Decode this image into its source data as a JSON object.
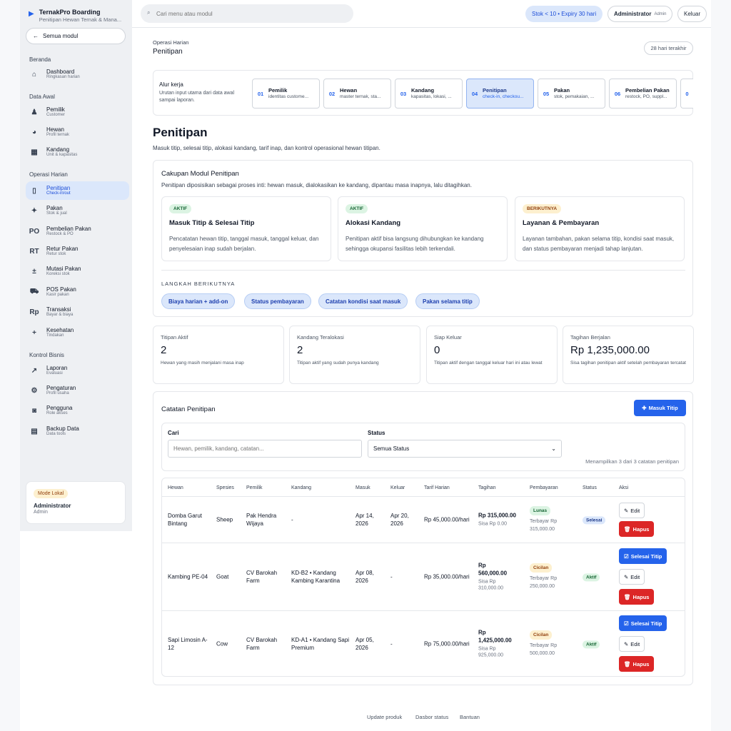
{
  "brand": {
    "title": "TernakPro Boarding",
    "subtitle": "Penitipan Hewan Ternak & Mana..."
  },
  "sidebar": {
    "all_modules": "Semua modul",
    "sections": [
      "Beranda",
      "Data Awal",
      "Operasi Harian",
      "Kontrol Bisnis"
    ],
    "items": [
      {
        "icon": "⌂",
        "label": "Dashboard",
        "sub": "Ringkasan harian"
      },
      {
        "icon": "♟",
        "label": "Pemilik",
        "sub": "Customer"
      },
      {
        "icon": "◕",
        "label": "Hewan",
        "sub": "Profil ternak"
      },
      {
        "icon": "▦",
        "label": "Kandang",
        "sub": "Unit & kapasitas"
      },
      {
        "icon": "▯",
        "label": "Penitipan",
        "sub": "Check-in/out"
      },
      {
        "icon": "✦",
        "label": "Pakan",
        "sub": "Stok & jual"
      },
      {
        "icon": "PO",
        "label": "Pembelian Pakan",
        "sub": "Restock & PO"
      },
      {
        "icon": "RT",
        "label": "Retur Pakan",
        "sub": "Retur stok"
      },
      {
        "icon": "±",
        "label": "Mutasi Pakan",
        "sub": "Koreksi stok"
      },
      {
        "icon": "⛟",
        "label": "POS Pakan",
        "sub": "Kasir pakan"
      },
      {
        "icon": "Rp",
        "label": "Transaksi",
        "sub": "Bayar & biaya"
      },
      {
        "icon": "+",
        "label": "Kesehatan",
        "sub": "Tindakan"
      },
      {
        "icon": "↗",
        "label": "Laporan",
        "sub": "Evaluasi"
      },
      {
        "icon": "⚙",
        "label": "Pengaturan",
        "sub": "Profil usaha"
      },
      {
        "icon": "◙",
        "label": "Pengguna",
        "sub": "Role akses"
      },
      {
        "icon": "▤",
        "label": "Backup Data",
        "sub": "Data tools"
      }
    ],
    "mode": {
      "badge": "Mode Lokal",
      "user": "Administrator",
      "role": "Admin"
    }
  },
  "topbar": {
    "search_placeholder": "Cari menu atau modul",
    "stock_alert": "Stok < 10 • Expiry 30 hari",
    "user": "Administrator",
    "role": "Admin",
    "logout": "Keluar"
  },
  "header": {
    "section": "Operasi Harian",
    "title": "Penitipan",
    "period": "28 hari terakhir"
  },
  "workflow": {
    "title": "Alur kerja",
    "desc": "Urutan input utama dari data awal sampai laporan.",
    "steps": [
      {
        "num": "01",
        "label": "Pemilik",
        "sub": "identitas custome..."
      },
      {
        "num": "02",
        "label": "Hewan",
        "sub": "master ternak, sta..."
      },
      {
        "num": "03",
        "label": "Kandang",
        "sub": "kapasitas, lokasi, ..."
      },
      {
        "num": "04",
        "label": "Penitipan",
        "sub": "check-in, checkou..."
      },
      {
        "num": "05",
        "label": "Pakan",
        "sub": "stok, pemakaian, ..."
      },
      {
        "num": "06",
        "label": "Pembelian Pakan",
        "sub": "restock, PO, suppl..."
      },
      {
        "num": "0"
      }
    ]
  },
  "page": {
    "title": "Penitipan",
    "subtitle": "Masuk titip, selesai titip, alokasi kandang, tarif inap, dan kontrol operasional hewan titipan."
  },
  "scope": {
    "title": "Cakupan Modul Penitipan",
    "desc": "Penitipan diposisikan sebagai proses inti: hewan masuk, dialokasikan ke kandang, dipantau masa inapnya, lalu ditagihkan.",
    "cards": [
      {
        "badge": "AKTIF",
        "title": "Masuk Titip & Selesai Titip",
        "desc": "Pencatatan hewan titip, tanggal masuk, tanggal keluar, dan penyelesaian inap sudah berjalan."
      },
      {
        "badge": "AKTIF",
        "title": "Alokasi Kandang",
        "desc": "Penitipan aktif bisa langsung dihubungkan ke kandang sehingga okupansi fasilitas lebih terkendali."
      },
      {
        "badge": "BERIKUTNYA",
        "title": "Layanan & Pembayaran",
        "desc": "Layanan tambahan, pakan selama titip, kondisi saat masuk, dan status pembayaran menjadi tahap lanjutan."
      }
    ],
    "next_title": "LANGKAH BERIKUTNYA",
    "next_steps": [
      "Biaya harian + add-on",
      "Status pembayaran",
      "Catatan kondisi saat masuk",
      "Pakan selama titip"
    ]
  },
  "stats": [
    {
      "label": "Titipan Aktif",
      "value": "2",
      "desc": "Hewan yang masih menjalani masa inap"
    },
    {
      "label": "Kandang Teralokasi",
      "value": "2",
      "desc": "Titipan aktif yang sudah punya kandang"
    },
    {
      "label": "Siap Keluar",
      "value": "0",
      "desc": "Titipan aktif dengan tanggal keluar hari ini atau lewat"
    },
    {
      "label": "Tagihan Berjalan",
      "value": "Rp 1,235,000.00",
      "desc": "Sisa tagihan penitipan aktif setelah pembayaran tercatat"
    }
  ],
  "records": {
    "title": "Catatan Penitipan",
    "add_button": "Masuk Titip",
    "search_label": "Cari",
    "search_placeholder": "Hewan, pemilik, kandang, catatan...",
    "status_label": "Status",
    "status_value": "Semua Status",
    "count": "Menampilkan 3 dari 3 catatan penitipan",
    "columns": [
      "Hewan",
      "Spesies",
      "Pemilik",
      "Kandang",
      "Masuk",
      "Keluar",
      "Tarif Harian",
      "Tagihan",
      "Pembayaran",
      "Status",
      "Aksi"
    ],
    "rows": [
      {
        "hewan": "Domba Garut Bintang",
        "spesies": "Sheep",
        "pemilik": "Pak Hendra Wijaya",
        "kandang": "-",
        "masuk": "Apr 14, 2026",
        "keluar": "Apr 20, 2026",
        "tarif": "Rp 45,000.00/hari",
        "tagihan": "Rp 315,000.00",
        "sisa": "Sisa Rp 0.00",
        "bayar_status": "Lunas",
        "terbayar": "Terbayar Rp 315,000.00",
        "status": "Selesai",
        "actions": [
          "Edit",
          "Hapus"
        ]
      },
      {
        "hewan": "Kambing PE-04",
        "spesies": "Goat",
        "pemilik": "CV Barokah Farm",
        "kandang": "KD-B2 • Kandang Kambing Karantina",
        "masuk": "Apr 08, 2026",
        "keluar": "-",
        "tarif": "Rp 35,000.00/hari",
        "tagihan": "Rp 560,000.00",
        "sisa": "Sisa Rp 310,000.00",
        "bayar_status": "Cicilan",
        "terbayar": "Terbayar Rp 250,000.00",
        "status": "Aktif",
        "actions": [
          "Selesai Titip",
          "Edit",
          "Hapus"
        ]
      },
      {
        "hewan": "Sapi Limosin A-12",
        "spesies": "Cow",
        "pemilik": "CV Barokah Farm",
        "kandang": "KD-A1 • Kandang Sapi Premium",
        "masuk": "Apr 05, 2026",
        "keluar": "-",
        "tarif": "Rp 75,000.00/hari",
        "tagihan": "Rp 1,425,000.00",
        "sisa": "Sisa Rp 925,000.00",
        "bayar_status": "Cicilan",
        "terbayar": "Terbayar Rp 500,000.00",
        "status": "Aktif",
        "actions": [
          "Selesai Titip",
          "Edit",
          "Hapus"
        ]
      }
    ]
  },
  "footer": [
    "Update produk",
    "Dasbor status",
    "Bantuan"
  ]
}
